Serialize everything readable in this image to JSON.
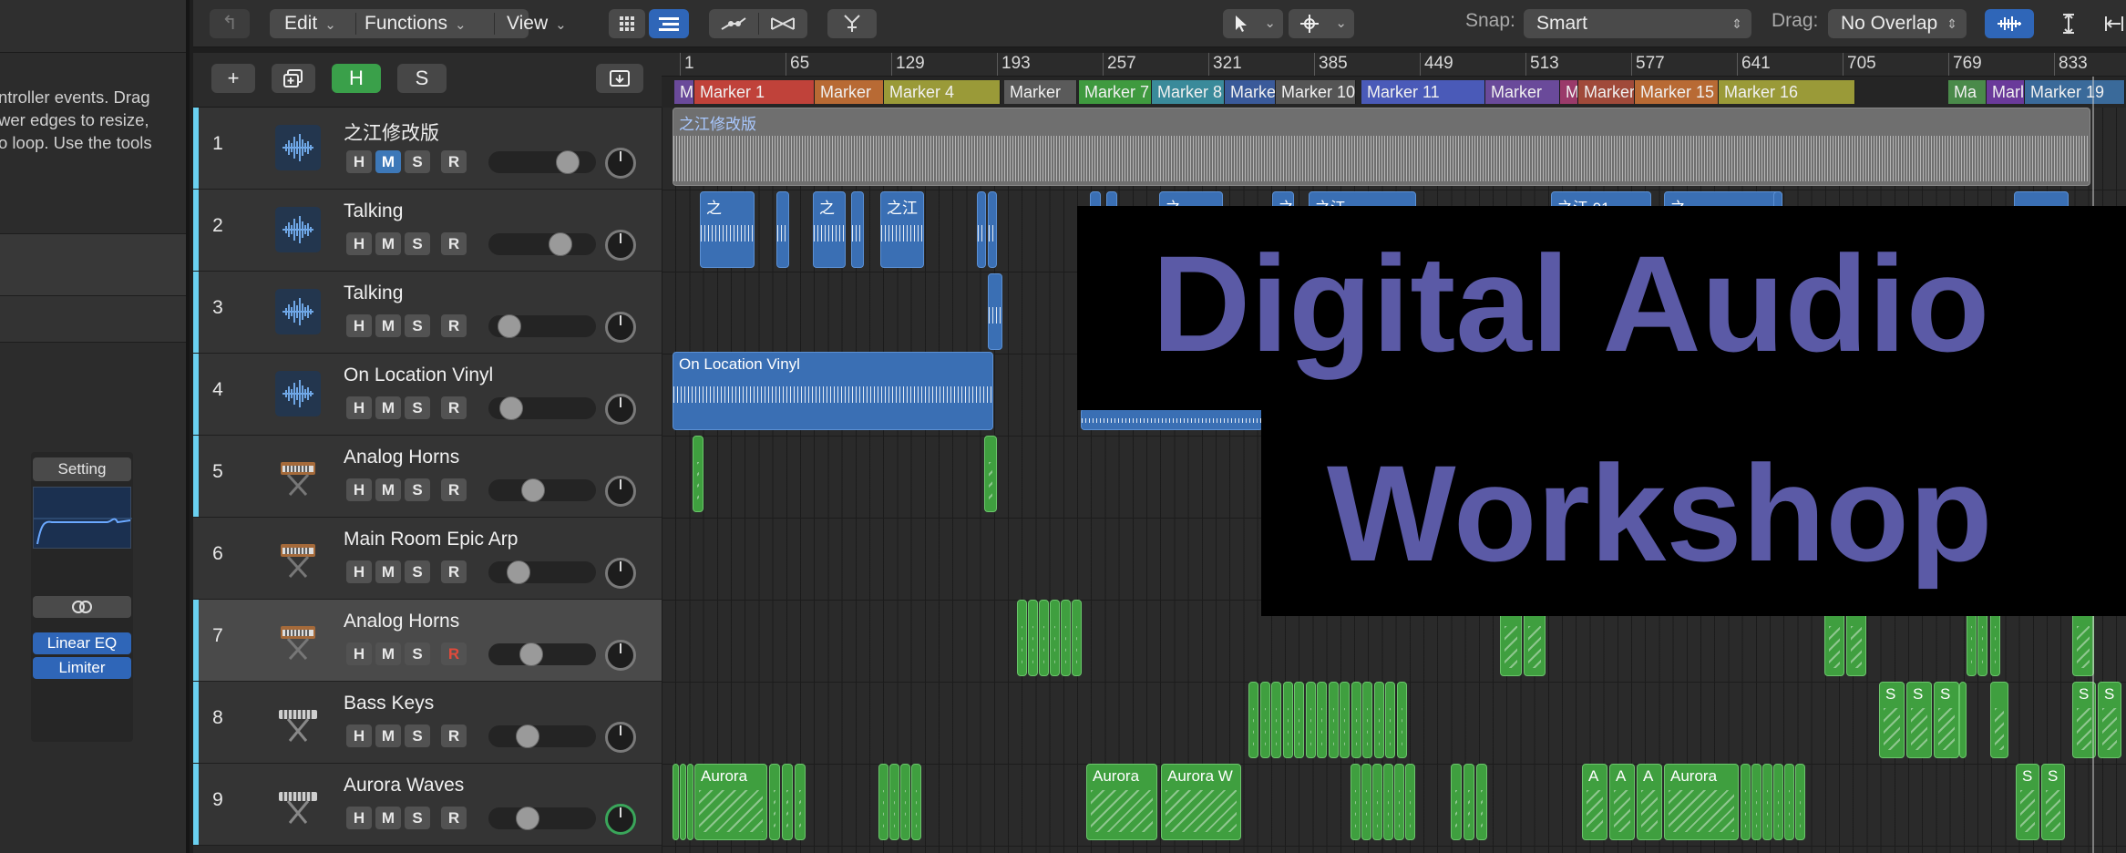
{
  "inspector": {
    "help_lines": [
      "ntroller events. Drag",
      "wer edges to resize,",
      "o loop. Use the tools"
    ],
    "setting_label": "Setting",
    "plugins": [
      "Linear EQ",
      "Limiter"
    ]
  },
  "toolbar": {
    "edit_label": "Edit",
    "functions_label": "Functions",
    "view_label": "View",
    "snap_label": "Snap:",
    "snap_value": "Smart",
    "drag_label": "Drag:",
    "drag_value": "No Overlap"
  },
  "track_header": {
    "add": "+",
    "dup": "⧉",
    "h": "H",
    "s": "S"
  },
  "tracks": [
    {
      "num": "1",
      "name": "之江修改版",
      "icon": "waveform-icon"
    },
    {
      "num": "2",
      "name": "Talking",
      "icon": "waveform-icon"
    },
    {
      "num": "3",
      "name": "Talking",
      "icon": "waveform-icon"
    },
    {
      "num": "4",
      "name": "On Location Vinyl",
      "icon": "waveform-icon"
    },
    {
      "num": "5",
      "name": "Analog Horns",
      "icon": "synth-icon"
    },
    {
      "num": "6",
      "name": "Main Room Epic Arp",
      "icon": "synth-icon"
    },
    {
      "num": "7",
      "name": "Analog Horns",
      "icon": "synth-icon"
    },
    {
      "num": "8",
      "name": "Bass Keys",
      "icon": "keyboard-icon"
    },
    {
      "num": "9",
      "name": "Aurora Waves",
      "icon": "keyboard-icon"
    }
  ],
  "ruler": [
    "1",
    "65",
    "129",
    "193",
    "257",
    "321",
    "385",
    "449",
    "513",
    "577",
    "641",
    "705",
    "769",
    "833"
  ],
  "markers": [
    "M",
    "Marker 1",
    "Marker",
    "Marker 4",
    "Marker",
    "Marker 7",
    "Marker 8",
    "Marke",
    "Marker 10",
    "Marker 11",
    "Marker",
    "M",
    "Marker",
    "Marker 15",
    "Marker 16",
    "Ma",
    "Marl",
    "Marker 19"
  ],
  "regions": {
    "track1_label": "之江修改版",
    "track2_labels": [
      "之",
      "之",
      "之江",
      "之",
      "之江 90",
      "之江",
      "之江 91",
      "之"
    ],
    "track4_label": "On Location Vinyl",
    "aurora_labels": [
      "Aurora",
      "Aurora",
      "Aurora W",
      "A",
      "A",
      "A",
      "Aurora",
      "S",
      "S"
    ],
    "bass_labels": [
      "S",
      "S",
      "S",
      "S",
      "S"
    ]
  },
  "overlay": {
    "line1": "Digital Audio",
    "line2": "Workshop"
  },
  "colors": {
    "accent": "#6ad0f0",
    "audio_region": "#3a6fb4",
    "midi_region": "#3f9f3f",
    "overlay_text": "#5b5aa6"
  }
}
